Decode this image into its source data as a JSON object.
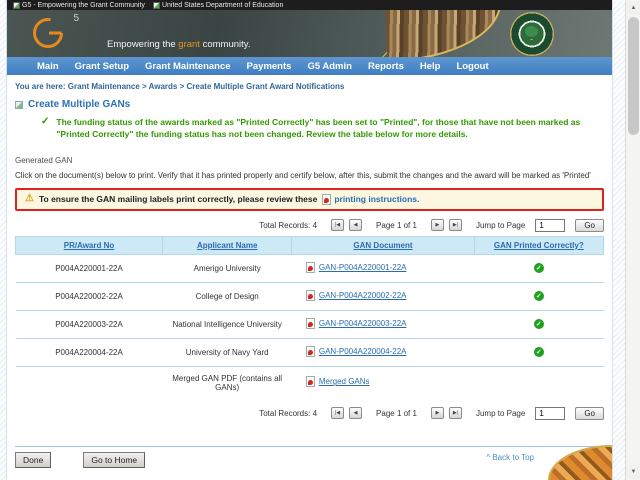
{
  "browser": {
    "tabs": [
      {
        "title": "G5 - Empowering the Grant Community"
      },
      {
        "title": "United States Department of Education"
      }
    ]
  },
  "header": {
    "logo_sup": "5",
    "tagline_pre": "Empowering the",
    "tagline_highlight": "grant",
    "tagline_post": "community."
  },
  "nav": {
    "items": [
      "Main",
      "Grant Setup",
      "Grant Maintenance",
      "Payments",
      "G5 Admin",
      "Reports",
      "Help",
      "Logout"
    ]
  },
  "breadcrumb": {
    "label": "You are here:",
    "path": "Grant Maintenance > Awards > Create Multiple Grant Award Notifications"
  },
  "page": {
    "title": "Create Multiple GANs",
    "success_message": "The funding status of the awards marked as \"Printed Correctly\" has been set to \"Printed\", for those that have not been marked as \"Printed Correctly\" the funding status has not been changed. Review the table below for more details.",
    "section_label": "Generated GAN",
    "instruction": "Click on the document(s) below to print. Verify that it has printed properly and certify below, after this, submit the changes and the award will be marked as 'Printed'",
    "warning_text": "To ensure the GAN mailing labels print correctly, please review these",
    "warning_link": "printing instructions."
  },
  "pagination": {
    "total_label": "Total Records: 4",
    "page_label": "Page 1 of 1",
    "jump_label": "Jump to Page",
    "jump_value": "1",
    "go_label": "Go"
  },
  "icons": {
    "first": "|◀",
    "prev": "◀",
    "next": "▶",
    "last": "▶|",
    "check": "✓",
    "warning": "⚠",
    "success_check": "✓",
    "scroll_up": "▲",
    "scroll_down": "▼"
  },
  "table": {
    "headers": [
      "PR/Award No",
      "Applicant Name",
      "GAN Document",
      "GAN Printed Correctly?"
    ],
    "rows": [
      {
        "award_no": "P004A220001-22A",
        "applicant": "Amerigo University",
        "doc": "GAN-P004A220001-22A",
        "printed": "yes"
      },
      {
        "award_no": "P004A220002-22A",
        "applicant": "College of Design",
        "doc": "GAN-P004A220002-22A",
        "printed": "yes"
      },
      {
        "award_no": "P004A220003-22A",
        "applicant": "National Intelligence University",
        "doc": "GAN-P004A220003-22A",
        "printed": "yes"
      },
      {
        "award_no": "P004A220004-22A",
        "applicant": "University of Navy Yard",
        "doc": "GAN-P004A220004-22A",
        "printed": "yes"
      },
      {
        "award_no": "",
        "applicant": "Merged GAN PDF (contains all GANs)",
        "doc": "Merged GANs",
        "printed": ""
      }
    ]
  },
  "footer": {
    "done_label": "Done",
    "home_label": "Go to Home",
    "back_to_top": "^ Back to Top"
  },
  "colors": {
    "navbar_blue": "#3f7ec2",
    "link_blue": "#2a6cb0",
    "success_green": "#339900",
    "warning_border_red": "#dd2222",
    "warning_bg": "#fbf7e1",
    "check_green": "#1ea11e",
    "logo_orange": "#e8891d",
    "table_header_bg": "#cde9f5"
  }
}
